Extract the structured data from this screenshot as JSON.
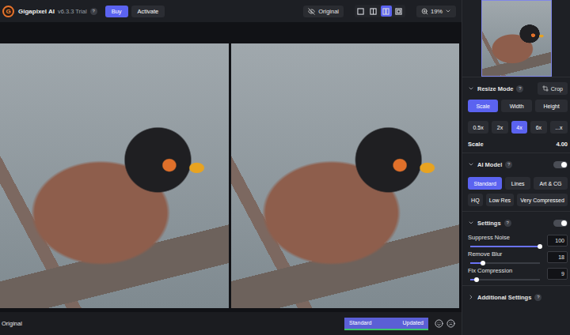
{
  "app": {
    "logo": "G",
    "name": "Gigapixel AI",
    "version": "v6.3.3 Trial",
    "help": "?"
  },
  "toolbar": {
    "buttons": [
      {
        "label": "Buy",
        "kind": "primary"
      },
      {
        "label": "Activate",
        "kind": "secondary"
      }
    ],
    "compare": "Original",
    "view_modes": [
      {
        "kind": "single",
        "selected": false
      },
      {
        "kind": "split",
        "selected": false
      },
      {
        "kind": "side",
        "selected": true
      },
      {
        "kind": "grid",
        "selected": false
      }
    ],
    "zoom": "19%"
  },
  "status_bar": {
    "label": "Original",
    "model": "Standard",
    "state": "Updated",
    "level": 1
  },
  "panel": {
    "resize": {
      "title": "Resize Mode",
      "help": "?",
      "expanded": true,
      "crop": "Crop",
      "modes": [
        {
          "label": "Scale",
          "selected": true
        },
        {
          "label": "Width",
          "selected": false
        },
        {
          "label": "Height",
          "selected": false
        }
      ],
      "factors": [
        {
          "label": "0.5x",
          "selected": false
        },
        {
          "label": "2x",
          "selected": false
        },
        {
          "label": "4x",
          "selected": true
        },
        {
          "label": "6x",
          "selected": false
        },
        {
          "label": "...x",
          "selected": false
        }
      ],
      "scale_label": "Scale",
      "scale_value": "4.00"
    },
    "ai_model": {
      "title": "AI Model",
      "help": "?",
      "expanded": true,
      "on": true,
      "rows": [
        [
          {
            "label": "Standard",
            "selected": true
          },
          {
            "label": "Lines",
            "selected": false
          },
          {
            "label": "Art & CG",
            "selected": false
          }
        ],
        [
          {
            "label": "HQ",
            "selected": false
          },
          {
            "label": "Low Res",
            "selected": false
          },
          {
            "label": "Very Compressed",
            "selected": false
          }
        ]
      ]
    },
    "settings": {
      "title": "Settings",
      "help": "?",
      "expanded": true,
      "on": true,
      "sliders": [
        {
          "label": "Suppress Noise",
          "level": 1,
          "value": "100"
        },
        {
          "label": "Remove Blur",
          "level": 0.18,
          "value": "18"
        },
        {
          "label": "Fix Compression",
          "level": 0.09,
          "value": "9"
        }
      ]
    },
    "additional": {
      "title": "Additional Settings",
      "help": "?",
      "expanded": false
    }
  }
}
